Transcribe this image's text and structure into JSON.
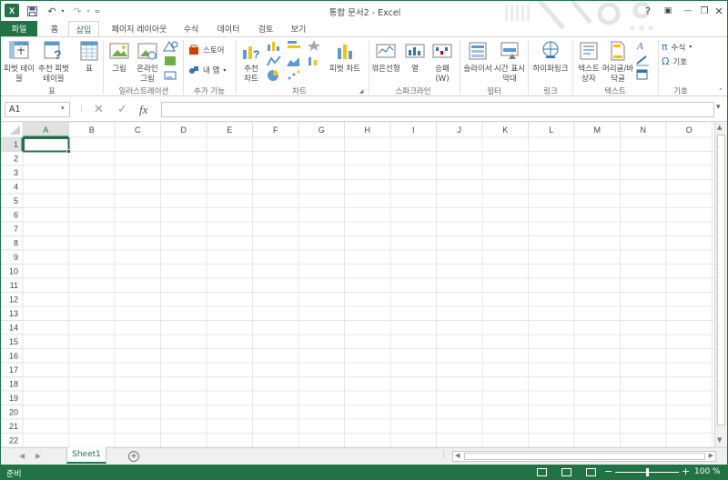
{
  "window": {
    "title": "통합 문서2 - Excel",
    "controls": {
      "help": "?",
      "ribbon_options": "▣",
      "minimize": "—",
      "restore": "❐",
      "close": "✕"
    }
  },
  "app": {
    "logo": "X"
  },
  "quick_access": {
    "customize": "="
  },
  "tabs": [
    {
      "id": "file",
      "label": "파일"
    },
    {
      "id": "home",
      "label": "홈"
    },
    {
      "id": "insert",
      "label": "삽입"
    },
    {
      "id": "page_layout",
      "label": "페이지 레이아웃"
    },
    {
      "id": "formulas",
      "label": "수식"
    },
    {
      "id": "data",
      "label": "데이터"
    },
    {
      "id": "review",
      "label": "검토"
    },
    {
      "id": "view",
      "label": "보기"
    }
  ],
  "active_tab": "insert",
  "ribbon": {
    "pivot_table": "피벗 테이블",
    "recommended_pivot": "추천 피벗 테이블",
    "table": "표",
    "group_tables": "표",
    "pictures": "그림",
    "online_pictures": "온라인 그림",
    "group_illustrations": "일러스트레이션",
    "store": "스토어",
    "my_apps": "내 앱",
    "group_apps": "추가 기능",
    "recommended_charts": "추천 차트",
    "pivot_chart": "피벗 차트",
    "group_charts": "차트",
    "spark_line": "꺾은선형",
    "spark_column": "열",
    "spark_winloss": "승패 (W)",
    "group_sparklines": "스파크라인",
    "slicer": "슬라이서",
    "timeline": "시간 표시 막대",
    "group_filters": "필터",
    "hyperlink": "하이퍼링크",
    "group_links": "링크",
    "textbox": "텍스트 상자",
    "header_footer": "머리글/바닥글",
    "group_text": "텍스트",
    "equation": "수식",
    "symbol": "기호",
    "group_symbols": "기호"
  },
  "formula_bar": {
    "name_box": "A1",
    "cancel_icon": "✕",
    "enter_icon": "✓",
    "function_icon": "fx",
    "formula": ""
  },
  "grid": {
    "columns": [
      "A",
      "B",
      "C",
      "D",
      "E",
      "F",
      "G",
      "H",
      "I",
      "J",
      "K",
      "L",
      "M",
      "N",
      "O"
    ],
    "rows": [
      "1",
      "2",
      "3",
      "4",
      "5",
      "6",
      "7",
      "8",
      "9",
      "10",
      "11",
      "12",
      "13",
      "14",
      "15",
      "16",
      "17",
      "18",
      "19",
      "20",
      "21",
      "22"
    ],
    "selected_cell": "A1"
  },
  "sheets": [
    {
      "name": "Sheet1",
      "active": true
    }
  ],
  "status": {
    "text": "준비",
    "zoom": "100 %",
    "zoom_percent": 100
  },
  "colors": {
    "accent": "#217346",
    "grid_line": "#e1e1e1",
    "header_bg": "#f3f3f3"
  }
}
